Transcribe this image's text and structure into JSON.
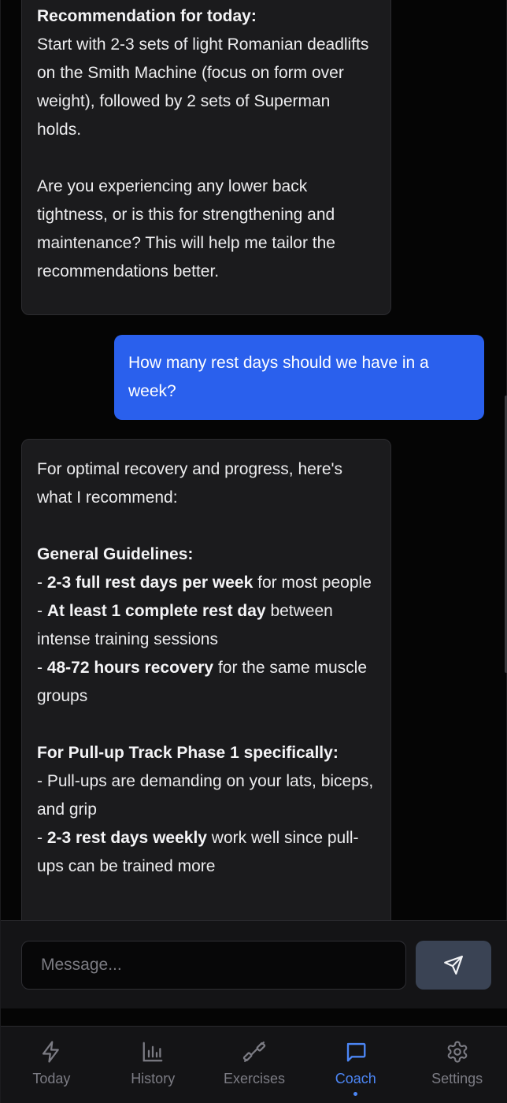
{
  "messages": [
    {
      "role": "assistant",
      "blocks": [
        {
          "bold": "Recommendation for today:",
          "text": "\nStart with 2-3 sets of light Romanian deadlifts on the Smith Machine (focus on form over weight), followed by 2 sets of Superman holds.\n\nAre you experiencing any lower back tightness, or is this for strengthening and maintenance? This will help me tailor the recommendations better."
        }
      ]
    },
    {
      "role": "user",
      "text": "How many rest days should we have in a week?"
    },
    {
      "role": "assistant",
      "blocks": [
        {
          "bold": "",
          "text": "For optimal recovery and progress, here's what I recommend:\n\n"
        },
        {
          "bold": "General Guidelines:",
          "text": "\n- "
        },
        {
          "bold": "2-3 full rest days per week",
          "text": " for most people\n- "
        },
        {
          "bold": "At least 1 complete rest day",
          "text": " between intense training sessions\n- "
        },
        {
          "bold": "48-72 hours recovery",
          "text": " for the same muscle groups\n\n"
        },
        {
          "bold": "For Pull-up Track Phase 1 specifically:",
          "text": "\n- Pull-ups are demanding on your lats, biceps, and grip\n- "
        },
        {
          "bold": "2-3 rest days weekly",
          "text": " work well since pull-ups can be trained more"
        }
      ]
    }
  ],
  "composer": {
    "placeholder": "Message...",
    "value": "",
    "send_icon": "send-icon"
  },
  "nav": {
    "active": "Coach",
    "accent": "#4c86f5",
    "items": [
      {
        "label": "Today",
        "icon": "lightning-icon"
      },
      {
        "label": "History",
        "icon": "bar-chart-icon"
      },
      {
        "label": "Exercises",
        "icon": "dumbbell-icon"
      },
      {
        "label": "Coach",
        "icon": "chat-icon"
      },
      {
        "label": "Settings",
        "icon": "gear-icon"
      }
    ]
  },
  "colors": {
    "user_bubble": "#2a60ed",
    "assistant_bubble": "#1b1b1d",
    "background": "#050505"
  }
}
